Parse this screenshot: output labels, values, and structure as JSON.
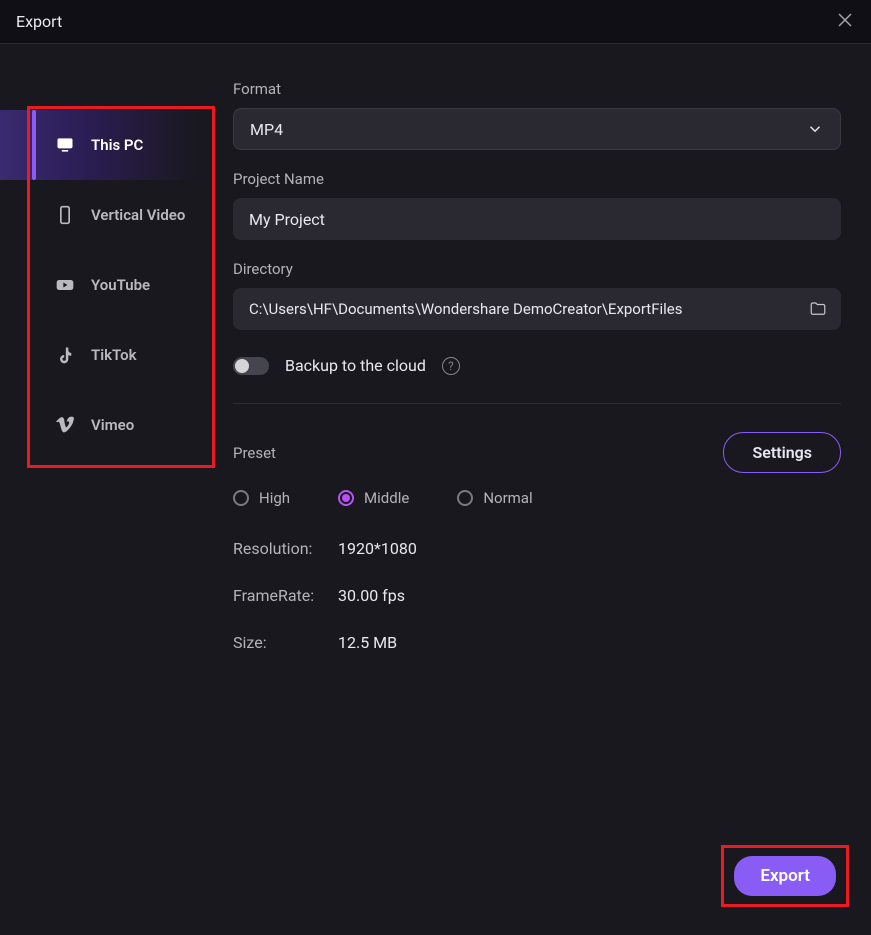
{
  "titlebar": {
    "title": "Export"
  },
  "sidebar": {
    "items": [
      {
        "label": "This PC"
      },
      {
        "label": "Vertical Video"
      },
      {
        "label": "YouTube"
      },
      {
        "label": "TikTok"
      },
      {
        "label": "Vimeo"
      }
    ]
  },
  "form": {
    "format_label": "Format",
    "format_value": "MP4",
    "project_label": "Project Name",
    "project_value": "My Project",
    "directory_label": "Directory",
    "directory_value": "C:\\Users\\HF\\Documents\\Wondershare DemoCreator\\ExportFiles",
    "backup_label": "Backup to the cloud"
  },
  "preset": {
    "label": "Preset",
    "settings_btn": "Settings",
    "options": [
      {
        "label": "High"
      },
      {
        "label": "Middle"
      },
      {
        "label": "Normal"
      }
    ],
    "specs": [
      {
        "label": "Resolution:",
        "value": "1920*1080"
      },
      {
        "label": "FrameRate:",
        "value": "30.00 fps"
      },
      {
        "label": "Size:",
        "value": "12.5 MB"
      }
    ]
  },
  "actions": {
    "export": "Export"
  }
}
